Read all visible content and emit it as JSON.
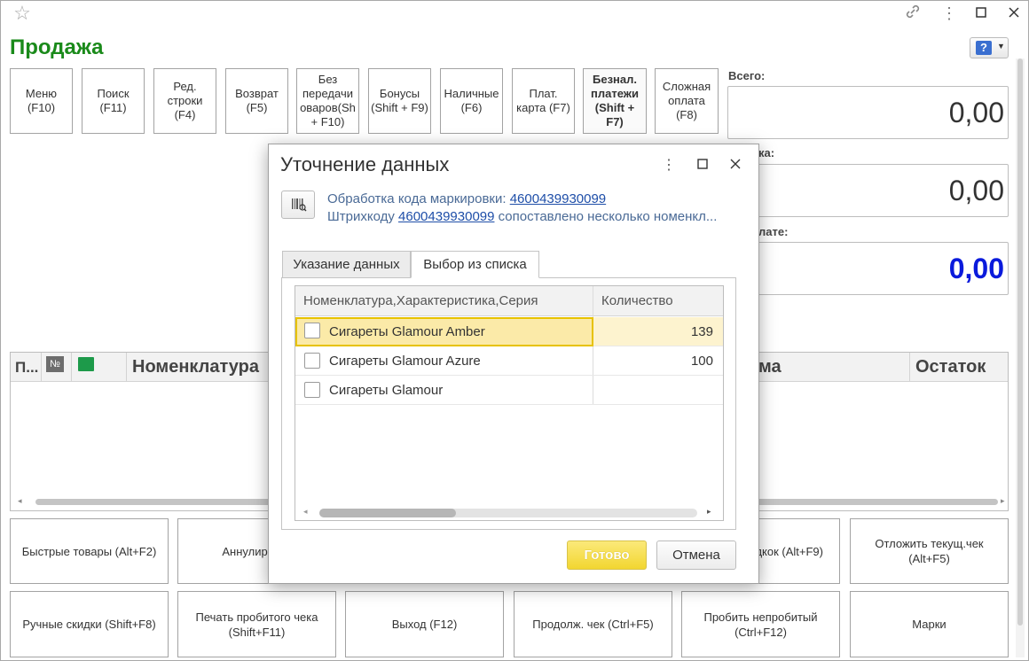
{
  "window": {
    "title": "Продажа",
    "help_icon": "question-icon"
  },
  "toolbar": [
    {
      "label": "Меню (F10)"
    },
    {
      "label": "Поиск (F11)"
    },
    {
      "label": "Ред. строки (F4)"
    },
    {
      "label": "Возврат (F5)"
    },
    {
      "label": "Без передачи оваров(Sh + F10)"
    },
    {
      "label": "Бонусы (Shift + F9)"
    },
    {
      "label": "Наличные (F6)"
    },
    {
      "label": "Плат. карта (F7)"
    },
    {
      "label": "Безнал. платежи (Shift + F7)"
    },
    {
      "label": "Сложная оплата (F8)"
    }
  ],
  "summary": {
    "total_label": "Всего:",
    "total_value": "0,00",
    "discount_label_partial": "ка:",
    "discount_value": "0,00",
    "topay_label_partial": "лате:",
    "topay_value": "0,00"
  },
  "grid": {
    "col_p": "П...",
    "col_no": "№",
    "col_name": "Номенклатура",
    "col_sum_partial": "ма",
    "col_rest": "Остаток"
  },
  "bottom_buttons": {
    "row1": [
      "Быстрые товары (Alt+F2)",
      "Аннулир. чек",
      "",
      "",
      "дкок (Alt+F9)",
      "Отложить текущ.чек (Alt+F5)"
    ],
    "row2": [
      "Ручные скидки (Shift+F8)",
      "Печать пробитого чека (Shift+F11)",
      "Выход (F12)",
      "Продолж. чек (Ctrl+F5)",
      "Пробить непробитый (Ctrl+F12)",
      "Марки"
    ]
  },
  "dialog": {
    "title": "Уточнение данных",
    "info_line1_prefix": "Обработка кода маркировки: ",
    "info_line1_link": "4600439930099",
    "info_line2_prefix": "Штрихкоду ",
    "info_line2_link": "4600439930099",
    "info_line2_suffix": " сопоставлено несколько номенкл...",
    "tabs": [
      "Указание данных",
      "Выбор из списка"
    ],
    "table": {
      "headers": [
        "Номенклатура,Характеристика,Серия",
        "Количество"
      ],
      "rows": [
        {
          "name": "Сигареты Glamour Amber",
          "qty": "139"
        },
        {
          "name": "Сигареты Glamour Azure",
          "qty": "100"
        },
        {
          "name": "Сигареты Glamour",
          "qty": ""
        }
      ]
    },
    "ok_label": "Готово",
    "cancel_label": "Отмена"
  },
  "colors": {
    "title_green": "#1a8a1a",
    "topay_blue": "#0a1adc",
    "selected_row": "#fbeaa8",
    "ok_button": "#f2d630"
  }
}
